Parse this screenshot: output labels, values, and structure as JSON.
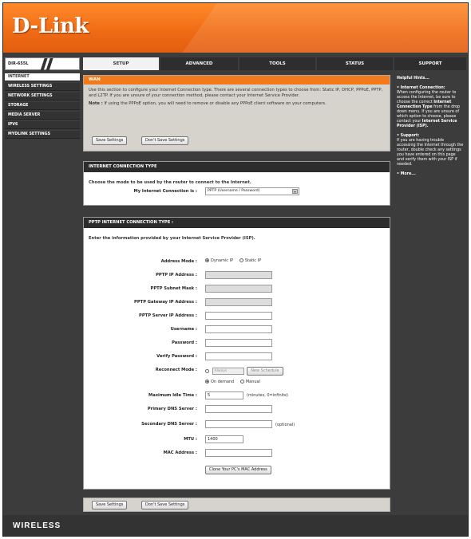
{
  "brand": {
    "logo": "D-Link",
    "model": "DIR-655L",
    "footer": "WIRELESS"
  },
  "tabs": [
    "SETUP",
    "ADVANCED",
    "TOOLS",
    "STATUS",
    "SUPPORT"
  ],
  "sidebar": [
    "INTERNET",
    "WIRELESS SETTINGS",
    "NETWORK SETTINGS",
    "STORAGE",
    "MEDIA SERVER",
    "IPV6",
    "MYDLINK SETTINGS"
  ],
  "intro": {
    "heading": "WAN",
    "text": "Use this section to configure your Internet Connection type. There are several connection types to choose from: Static IP, DHCP, PPPoE, PPTP, and L2TP. If you are unsure of your connection method, please contact your Internet Service Provider.",
    "note_label": "Note :",
    "note": "If using the PPPoE option, you will need to remove or disable any PPPoE client software on your computers.",
    "save": "Save Settings",
    "dont_save": "Don't Save Settings"
  },
  "conn_type": {
    "heading": "INTERNET CONNECTION TYPE",
    "instruction": "Choose the mode to be used by the router to connect to the Internet.",
    "label": "My Internet Connection is :",
    "value": "PPTP (Username / Password)"
  },
  "pptp": {
    "heading": "PPTP INTERNET CONNECTION TYPE :",
    "instruction": "Enter the information provided by your Internet Service Provider (ISP).",
    "address_mode_label": "Address Mode :",
    "dynamic_ip": "Dynamic IP",
    "static_ip": "Static IP",
    "ip_label": "PPTP IP Address :",
    "subnet_label": "PPTP Subnet Mask :",
    "gateway_label": "PPTP Gateway IP Address :",
    "server_label": "PPTP Server IP Address :",
    "username_label": "Username :",
    "password_label": "Password :",
    "verify_label": "Verify Password :",
    "reconnect_label": "Reconnect Mode :",
    "always": "Always",
    "new_schedule": "New Schedule",
    "on_demand": "On demand",
    "manual": "Manual",
    "idle_label": "Maximum Idle Time :",
    "idle_value": "5",
    "idle_unit": "(minutes, 0=infinite)",
    "dns1_label": "Primary DNS Server :",
    "dns2_label": "Secondary DNS Server :",
    "optional": "(optional)",
    "mtu_label": "MTU :",
    "mtu_value": "1400",
    "mac_label": "MAC Address :",
    "clone": "Clone Your PC's MAC Address"
  },
  "help": {
    "title": "Helpful Hints...",
    "hint1_title": "Internet Connection:",
    "hint1_a": "When configuring the router to access the Internet, be sure to choose the correct",
    "hint1_bold": "Internet Connection Type",
    "hint1_b": "from the drop down menu. If you are unsure of which option to choose, please contact your",
    "hint1_bold2": "Internet Service Provider (ISP).",
    "hint2_title": "Support:",
    "hint2_text": "If you are having trouble accessing the Internet through the router, double check any settings you have entered on this page and verify them with your ISP if needed.",
    "more": "More..."
  }
}
